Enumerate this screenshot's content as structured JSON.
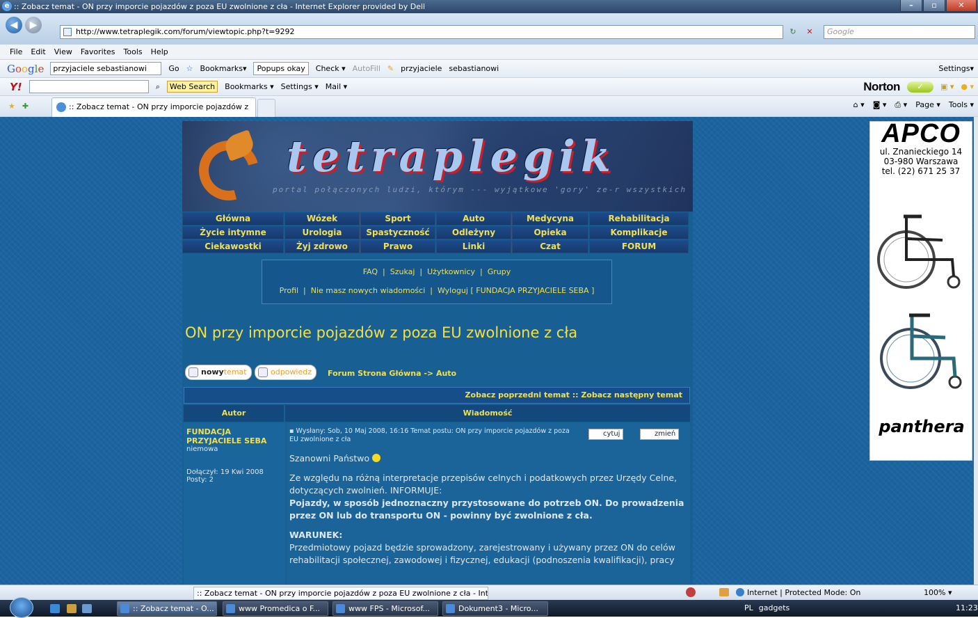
{
  "window": {
    "title": ":: Zobacz temat - ON przy imporcie pojazdów z poza EU zwolnione z cła - Internet Explorer provided by Dell",
    "controls": [
      "–",
      "▫",
      "✕"
    ]
  },
  "address": {
    "url": "http://www.tetraplegik.com/forum/viewtopic.php?t=9292",
    "search_placeholder": "Google"
  },
  "menubar": [
    "File",
    "Edit",
    "View",
    "Favorites",
    "Tools",
    "Help"
  ],
  "google_toolbar": {
    "logo": "Google",
    "query": "przyjaciele sebastianowi",
    "go": "Go",
    "bookmarks": "Bookmarks▾",
    "popups": "Popups okay",
    "check": "Check ▾",
    "autofill": "AutoFill",
    "term1": "przyjaciele",
    "term2": "sebastianowi",
    "settings": "Settings▾"
  },
  "yahoo_toolbar": {
    "logo": "Y!",
    "web_search": "Web Search",
    "bookmarks": "Bookmarks ▾",
    "settings": "Settings ▾",
    "mail": "Mail ▾",
    "norton": "Norton"
  },
  "tab": {
    "label": ":: Zobacz temat - ON przy imporcie pojazdów z p..."
  },
  "commandbar": {
    "page": "Page ▾",
    "tools": "Tools ▾"
  },
  "site": {
    "logo_text": "tetraplegik",
    "tagline": "portal połączonych ludzi, którym --- wyjątkowe 'gory' ze-r wszystkich - rodzaju uszkodzenia rdzenia kręgowego",
    "nav_rows": [
      [
        "Główna",
        "Wózek",
        "Sport",
        "Auto",
        "Medycyna",
        "Rehabilitacja"
      ],
      [
        "Życie intymne",
        "Urologia",
        "Spastyczność",
        "Odleżyny",
        "Opieka",
        "Komplikacje"
      ],
      [
        "Ciekawostki",
        "Żyj zdrowo",
        "Prawo",
        "Linki",
        "Czat",
        "FORUM"
      ]
    ],
    "top_menu_line1": "FAQ  |  Szukaj  |  Użytkownicy  |  Grupy",
    "top_menu_line2": "Profil  |  Nie masz nowych wiadomości  |  Wyloguj [ FUNDACJA PRZYJACIELE SEBA ]",
    "topic_title": "ON przy imporcie pojazdów z poza EU zwolnione z cła",
    "btn_new_1": "nowy",
    "btn_new_2": "temat",
    "btn_reply": "odpowiedz",
    "breadcrumb": "Forum Strona Główna -> Auto",
    "prev_next": "Zobacz poprzedni temat :: Zobacz następny temat",
    "col_author": "Autor",
    "col_message": "Wiadomość"
  },
  "post": {
    "author": "FUNDACJA PRZYJACIELE SEBA",
    "status": "niemowa",
    "joined": "Dołączył: 19 Kwi 2008",
    "posts": "Posty: 2",
    "meta": "Wysłany: Sob, 10 Maj 2008, 16:16    Temat postu: ON przy imporcie pojazdów z poza EU zwolnione z cła",
    "quote_btn": "cytuj",
    "edit_btn": "zmień",
    "greeting": "Szanowni Państwo",
    "p1": "Ze względu na różną interpretacje przepisów celnych i podatkowych przez Urzędy Celne, dotyczących zwolnień. INFORMUJE:",
    "p1_bold": "Pojazdy, w sposób jednoznaczny przystosowane do potrzeb ON. Do prowadzenia przez ON lub do transportu ON - powinny być zwolnione z cła.",
    "heading2": "WARUNEK:",
    "p2": "Przedmiotowy pojazd będzie sprowadzony, zarejestrowany i używany przez ON do celów rehabilitacji społecznej, zawodowej i fizycznej, edukacji (podnoszenia kwalifikacji), pracy"
  },
  "ad": {
    "brand": "APCO",
    "line1": "ul. Znanieckiego 14",
    "line2": "03-980 Warszawa",
    "line3": "tel. (22) 671 25 37",
    "brand2": "panthera"
  },
  "statusbar": {
    "text": ":: Zobacz temat - ON przy imporcie pojazdów z poza EU zwolnione z cła - Interne",
    "zone": "Internet | Protected Mode: On",
    "zoom": "100%  ▾"
  },
  "taskbar": {
    "tasks": [
      ":: Zobacz temat - O...",
      "www Promedica o F...",
      "www FPS - Microsof...",
      "Dokument3 - Micro..."
    ],
    "lang": "PL",
    "gadgets": "gadgets",
    "clock": "11:23"
  }
}
